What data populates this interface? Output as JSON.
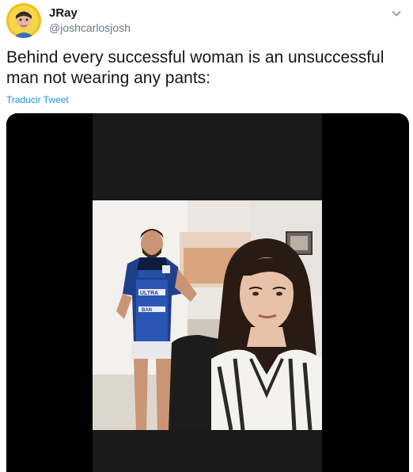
{
  "tweet": {
    "author_name": "JRay",
    "author_handle": "@joshcarlosjosh",
    "text": "Behind every successful woman is an unsuccessful man not wearing any pants:",
    "translate_label": "Traducir Tweet"
  },
  "media": {
    "jersey_text_1": "ULTRA",
    "jersey_text_2": "BAN"
  },
  "colors": {
    "accent": "#1b95e0",
    "secondary_text": "#657786",
    "avatar_bg": "#f2c21b"
  }
}
